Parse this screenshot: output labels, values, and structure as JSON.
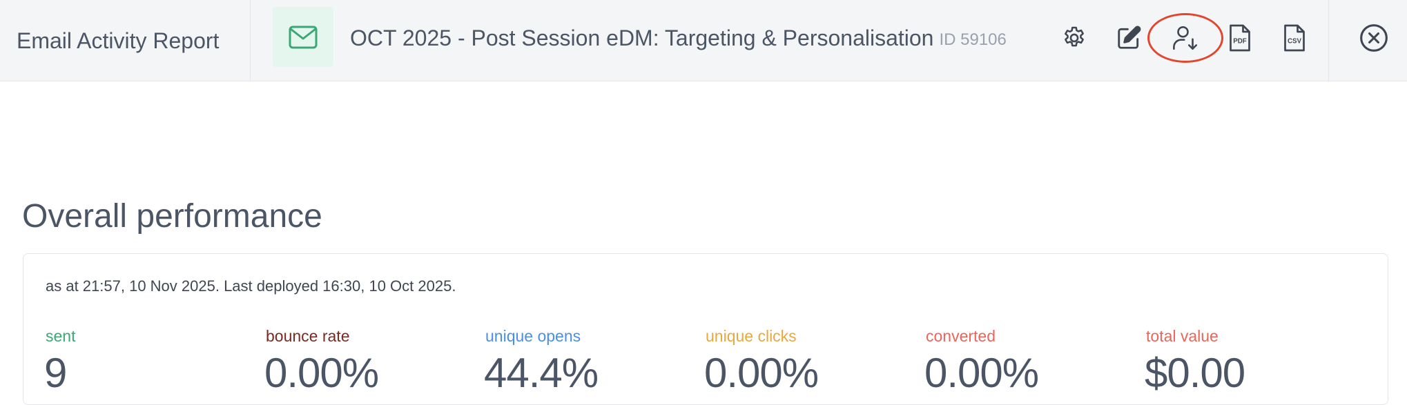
{
  "header": {
    "report_title": "Email Activity Report",
    "campaign_name": "OCT 2025 - Post Session eDM: Targeting & Personalisation",
    "campaign_id": "ID 59106"
  },
  "toolbar": {
    "icons": [
      "envelope-icon",
      "gear-icon",
      "edit-icon",
      "user-download-icon",
      "pdf-icon",
      "csv-icon",
      "close-icon"
    ],
    "pdf_text": "PDF",
    "csv_text": "CSV"
  },
  "overview": {
    "heading": "Overall performance",
    "as_at": "as at 21:57, 10 Nov 2025. Last deployed 16:30, 10 Oct 2025.",
    "stats": [
      {
        "label": "sent",
        "value": "9",
        "color": "#3aa876"
      },
      {
        "label": "bounce rate",
        "value": "0.00%",
        "color": "#7a2a22"
      },
      {
        "label": "unique opens",
        "value": "44.4%",
        "color": "#4a8fe7"
      },
      {
        "label": "unique clicks",
        "value": "0.00%",
        "color": "#e8a93a"
      },
      {
        "label": "converted",
        "value": "0.00%",
        "color": "#e8665a"
      },
      {
        "label": "total value",
        "value": "$0.00",
        "color": "#e8665a"
      }
    ]
  },
  "colors": {
    "accent_green": "#3aa876",
    "highlight_ring": "#e2462f",
    "topbar_bg": "#f4f5f7"
  }
}
